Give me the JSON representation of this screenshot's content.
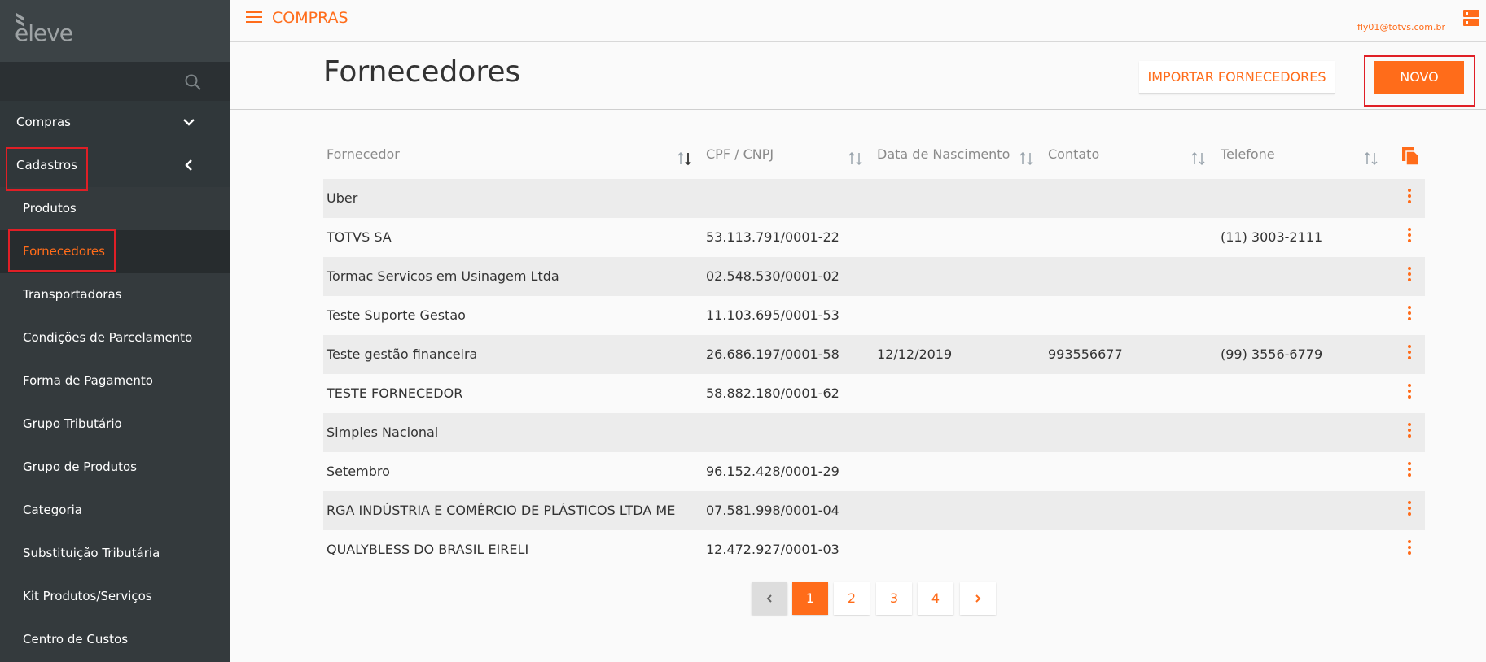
{
  "sidebar": {
    "brand": "eleve",
    "items": [
      {
        "label": "Compras"
      },
      {
        "label": "Cadastros"
      },
      {
        "label": "Produtos"
      },
      {
        "label": "Fornecedores"
      },
      {
        "label": "Transportadoras"
      },
      {
        "label": "Condições de Parcelamento"
      },
      {
        "label": "Forma de Pagamento"
      },
      {
        "label": "Grupo Tributário"
      },
      {
        "label": "Grupo de Produtos"
      },
      {
        "label": "Categoria"
      },
      {
        "label": "Substituição Tributária"
      },
      {
        "label": "Kit Produtos/Serviços"
      },
      {
        "label": "Centro de Custos"
      }
    ]
  },
  "topbar": {
    "app_title": "COMPRAS",
    "user_email": "fly01@totvs.com.br"
  },
  "header": {
    "title": "Fornecedores",
    "import_label": "IMPORTAR FORNECEDORES",
    "new_label": "NOVO"
  },
  "table": {
    "columns": [
      "Fornecedor",
      "CPF / CNPJ",
      "Data de Nascimento",
      "Contato",
      "Telefone"
    ],
    "rows": [
      [
        "Uber",
        "",
        "",
        "",
        ""
      ],
      [
        "TOTVS SA",
        "53.113.791/0001-22",
        "",
        "",
        "(11) 3003-2111"
      ],
      [
        "Tormac Servicos em Usinagem Ltda",
        "02.548.530/0001-02",
        "",
        "",
        ""
      ],
      [
        "Teste Suporte Gestao",
        "11.103.695/0001-53",
        "",
        "",
        ""
      ],
      [
        "Teste gestão financeira",
        "26.686.197/0001-58",
        "12/12/2019",
        "993556677",
        "(99) 3556-6779"
      ],
      [
        "TESTE FORNECEDOR",
        "58.882.180/0001-62",
        "",
        "",
        ""
      ],
      [
        "Simples Nacional",
        "",
        "",
        "",
        ""
      ],
      [
        "Setembro",
        "96.152.428/0001-29",
        "",
        "",
        ""
      ],
      [
        "RGA INDÚSTRIA E COMÉRCIO DE PLÁSTICOS LTDA ME",
        "07.581.998/0001-04",
        "",
        "",
        ""
      ],
      [
        "QUALYBLESS DO BRASIL EIRELI",
        "12.472.927/0001-03",
        "",
        "",
        ""
      ]
    ]
  },
  "pagination": {
    "pages": [
      "1",
      "2",
      "3",
      "4"
    ],
    "current": "1"
  },
  "colors": {
    "accent": "#ff6c1a",
    "sidebar_bg": "#343a3d",
    "highlight": "#e01f26"
  }
}
